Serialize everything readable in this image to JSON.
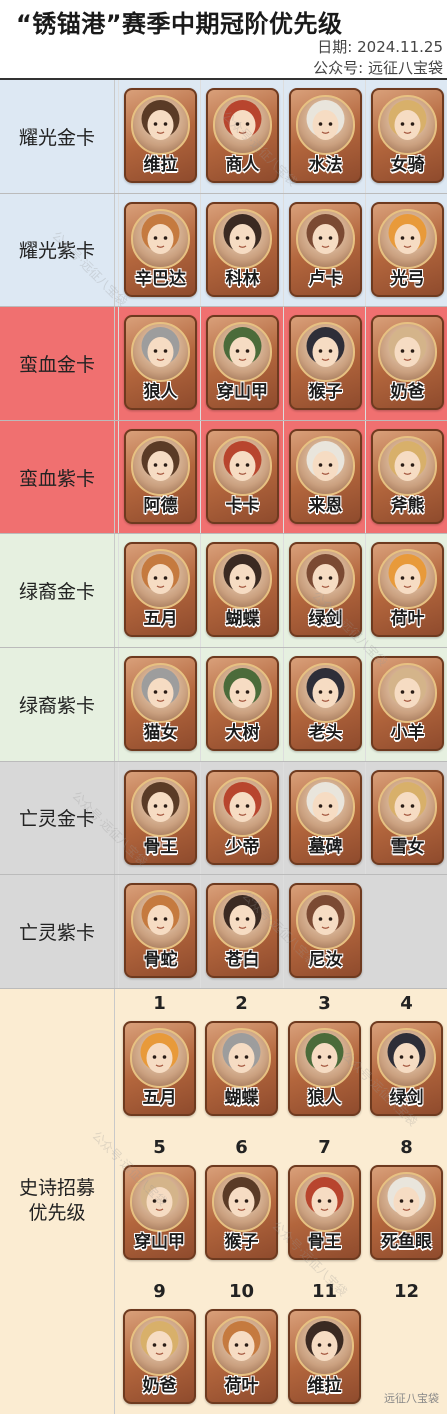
{
  "title": "“锈锚港”赛季中期冠阶优先级",
  "date": "日期:  2024.11.25",
  "wechat": "公众号:  远征八宝袋",
  "watermark": "公众号·远征八宝袋",
  "footer": "远征八宝袋",
  "colors": {
    "glory": "#dde8f3",
    "blood": "#f07070",
    "green": "#e6f0e0",
    "undead": "#d8d8d8",
    "epic": "#fbecd2"
  },
  "tiers": [
    {
      "label": "耀光金卡",
      "heroes": [
        "维拉",
        "商人",
        "水法",
        "女骑"
      ]
    },
    {
      "label": "耀光紫卡",
      "heroes": [
        "辛巴达",
        "科林",
        "卢卡",
        "光弓"
      ]
    },
    {
      "label": "蛮血金卡",
      "heroes": [
        "狼人",
        "穿山甲",
        "猴子",
        "奶爸"
      ]
    },
    {
      "label": "蛮血紫卡",
      "heroes": [
        "阿德",
        "卡卡",
        "来恩",
        "斧熊"
      ]
    },
    {
      "label": "绿裔金卡",
      "heroes": [
        "五月",
        "蝴蝶",
        "绿剑",
        "荷叶"
      ]
    },
    {
      "label": "绿裔紫卡",
      "heroes": [
        "猫女",
        "大树",
        "老头",
        "小羊"
      ]
    },
    {
      "label": "亡灵金卡",
      "heroes": [
        "骨王",
        "少帝",
        "墓碑",
        "雪女"
      ]
    },
    {
      "label": "亡灵紫卡",
      "heroes": [
        "骨蛇",
        "苍白",
        "尼汝"
      ]
    }
  ],
  "epic": {
    "label": "史诗招募\n优先级",
    "rows": [
      {
        "numbers": [
          "1",
          "2",
          "3",
          "4"
        ],
        "heroes": [
          "五月",
          "蝴蝶",
          "狼人",
          "绿剑"
        ]
      },
      {
        "numbers": [
          "5",
          "6",
          "7",
          "8"
        ],
        "heroes": [
          "穿山甲",
          "猴子",
          "骨王",
          "死鱼眼"
        ]
      },
      {
        "numbers": [
          "9",
          "10",
          "11",
          "12"
        ],
        "heroes": [
          "奶爸",
          "荷叶",
          "维拉"
        ]
      }
    ]
  }
}
